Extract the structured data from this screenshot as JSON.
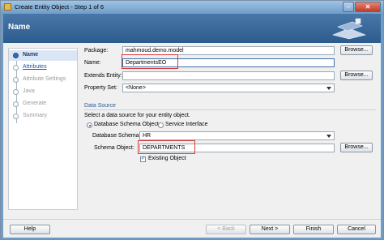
{
  "window": {
    "title": "Create Entity Object - Step 1 of 6",
    "minimize_glyph": "–",
    "close_glyph": "✕"
  },
  "header": {
    "title": "Name"
  },
  "nav": {
    "items": [
      {
        "label": "Name",
        "state": "active"
      },
      {
        "label": "Attributes",
        "state": "link"
      },
      {
        "label": "Attribute Settings",
        "state": "disabled"
      },
      {
        "label": "Java",
        "state": "disabled"
      },
      {
        "label": "Generate",
        "state": "disabled"
      },
      {
        "label": "Summary",
        "state": "disabled"
      }
    ]
  },
  "form": {
    "package_label": "Package:",
    "package_value": "mahmoud.demo.model",
    "name_label": "Name:",
    "name_value": "DepartmentsEO",
    "extends_label": "Extends Entity:",
    "extends_value": "",
    "property_set_label": "Property Set:",
    "property_set_value": "<None>",
    "browse_label": "Browse..."
  },
  "data_source": {
    "section_title": "Data Source",
    "description": "Select a data source for your entity object.",
    "radio_db": "Database Schema Object",
    "radio_service": "Service Interface",
    "db_schema_label": "Database Schema:",
    "db_schema_value": "HR",
    "schema_object_label": "Schema Object:",
    "schema_object_value": "DEPARTMENTS",
    "existing_object_label": "Existing Object"
  },
  "footer": {
    "help": "Help",
    "back": "< Back",
    "next": "Next >",
    "finish": "Finish",
    "cancel": "Cancel"
  }
}
